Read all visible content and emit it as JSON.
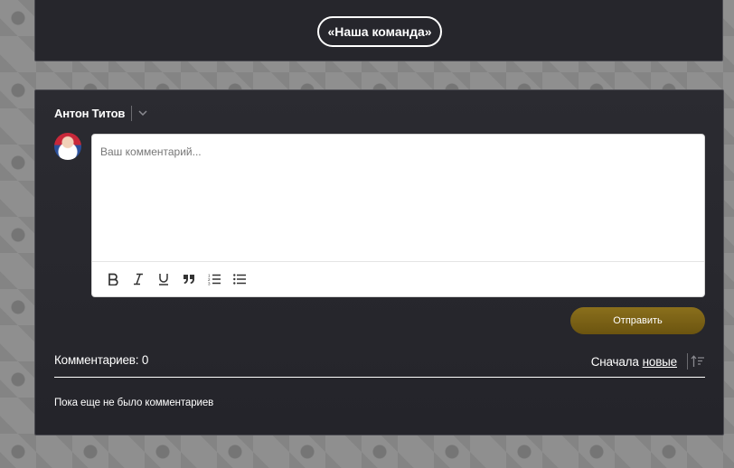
{
  "top": {
    "team_button_label": "«Наша команда»"
  },
  "comment_form": {
    "user_name": "Антон Титов",
    "placeholder": "Ваш комментарий...",
    "submit_label": "Отправить",
    "toolbar": [
      "bold-icon",
      "italic-icon",
      "underline-icon",
      "quote-icon",
      "ordered-list-icon",
      "bullet-list-icon"
    ]
  },
  "comments": {
    "count_label": "Комментариев: 0",
    "sort_prefix": "Сначала",
    "sort_value": "новые",
    "empty_message": "Пока еще не было комментариев"
  },
  "colors": {
    "panel_bg": "#26262c",
    "accent_button": "#7a6216",
    "page_bg": "#8f8f8f"
  }
}
